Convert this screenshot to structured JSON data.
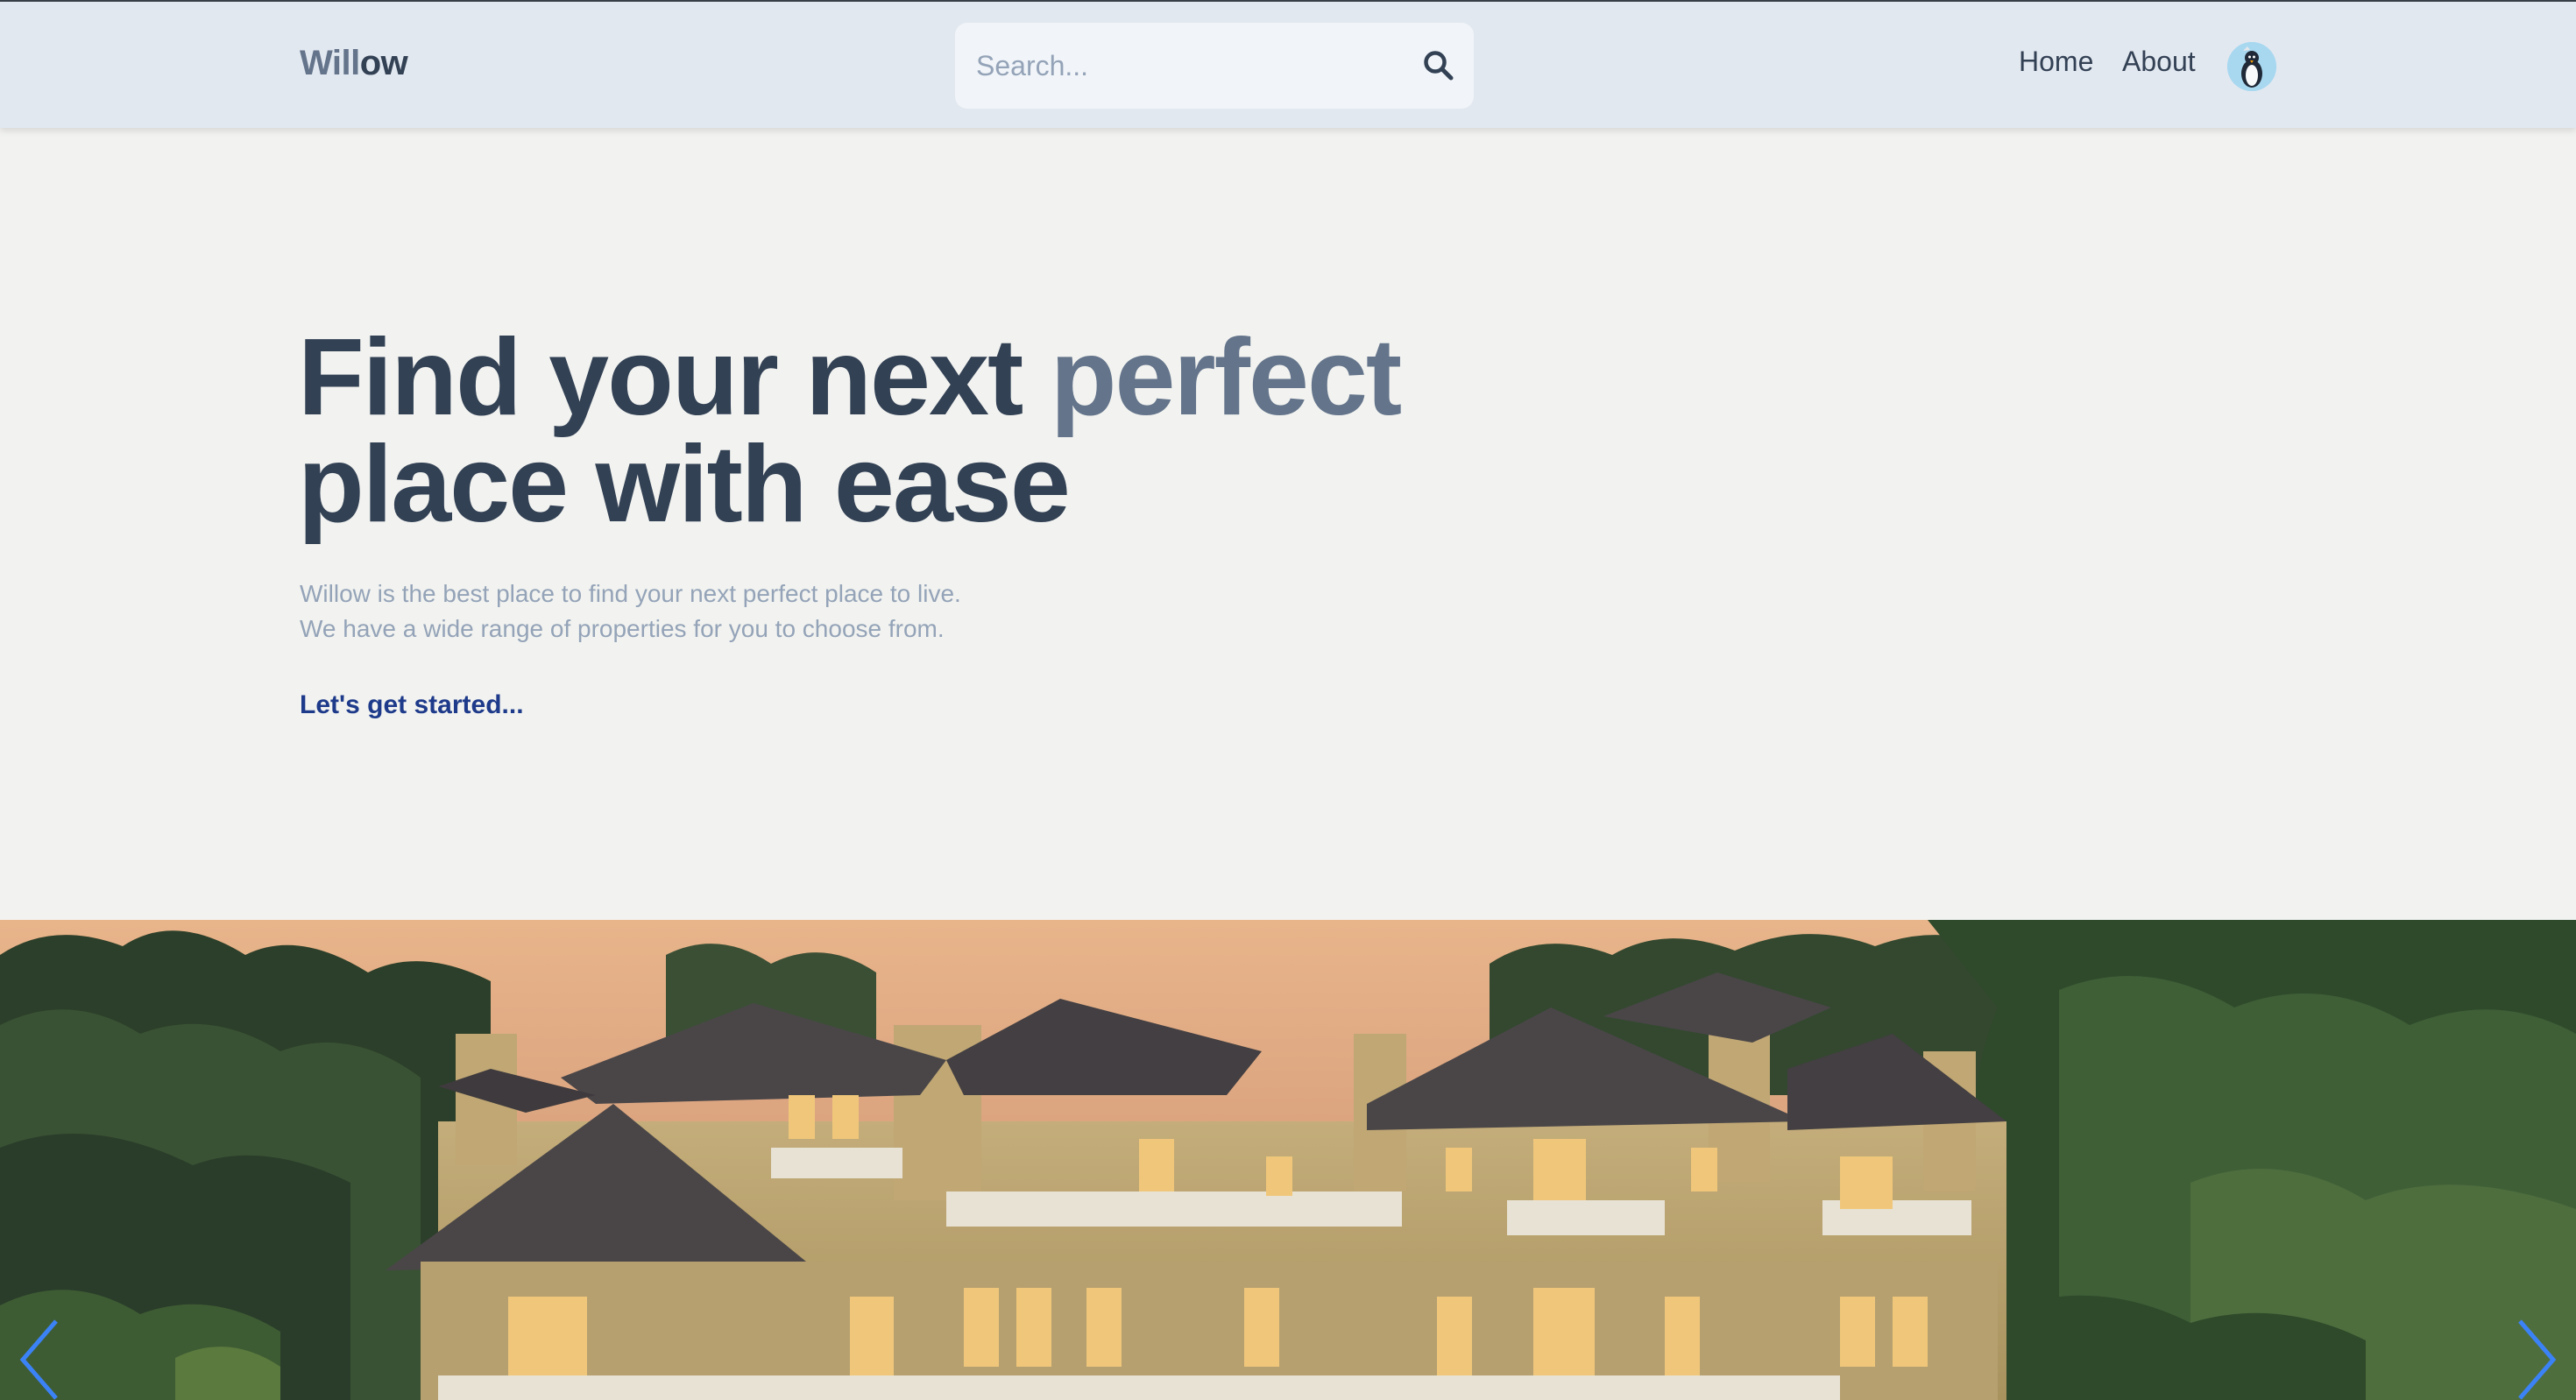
{
  "header": {
    "logo_part1": "Will",
    "logo_part2": "ow",
    "search_placeholder": "Search...",
    "search_icon": "search-icon",
    "nav": [
      {
        "label": "Home"
      },
      {
        "label": "About"
      }
    ],
    "avatar_icon": "penguin-avatar"
  },
  "hero": {
    "title_part1": "Find your next ",
    "title_accent": "perfect",
    "title_part2": "place with ease",
    "desc_line1": "Willow is the best place to find your next perfect place to live.",
    "desc_line2": "We have a wide range of properties for you to choose from.",
    "cta": "Let's get started..."
  },
  "slider": {
    "image": "mansion-photo",
    "prev_icon": "chevron-left-icon",
    "next_icon": "chevron-right-icon"
  },
  "colors": {
    "header_bg": "#e2e8f0",
    "page_bg": "#f2f3f0",
    "title": "#334155",
    "accent": "#64748b",
    "desc": "#94a3b8",
    "cta": "#1e3a8a",
    "arrow": "#3b82f6"
  }
}
